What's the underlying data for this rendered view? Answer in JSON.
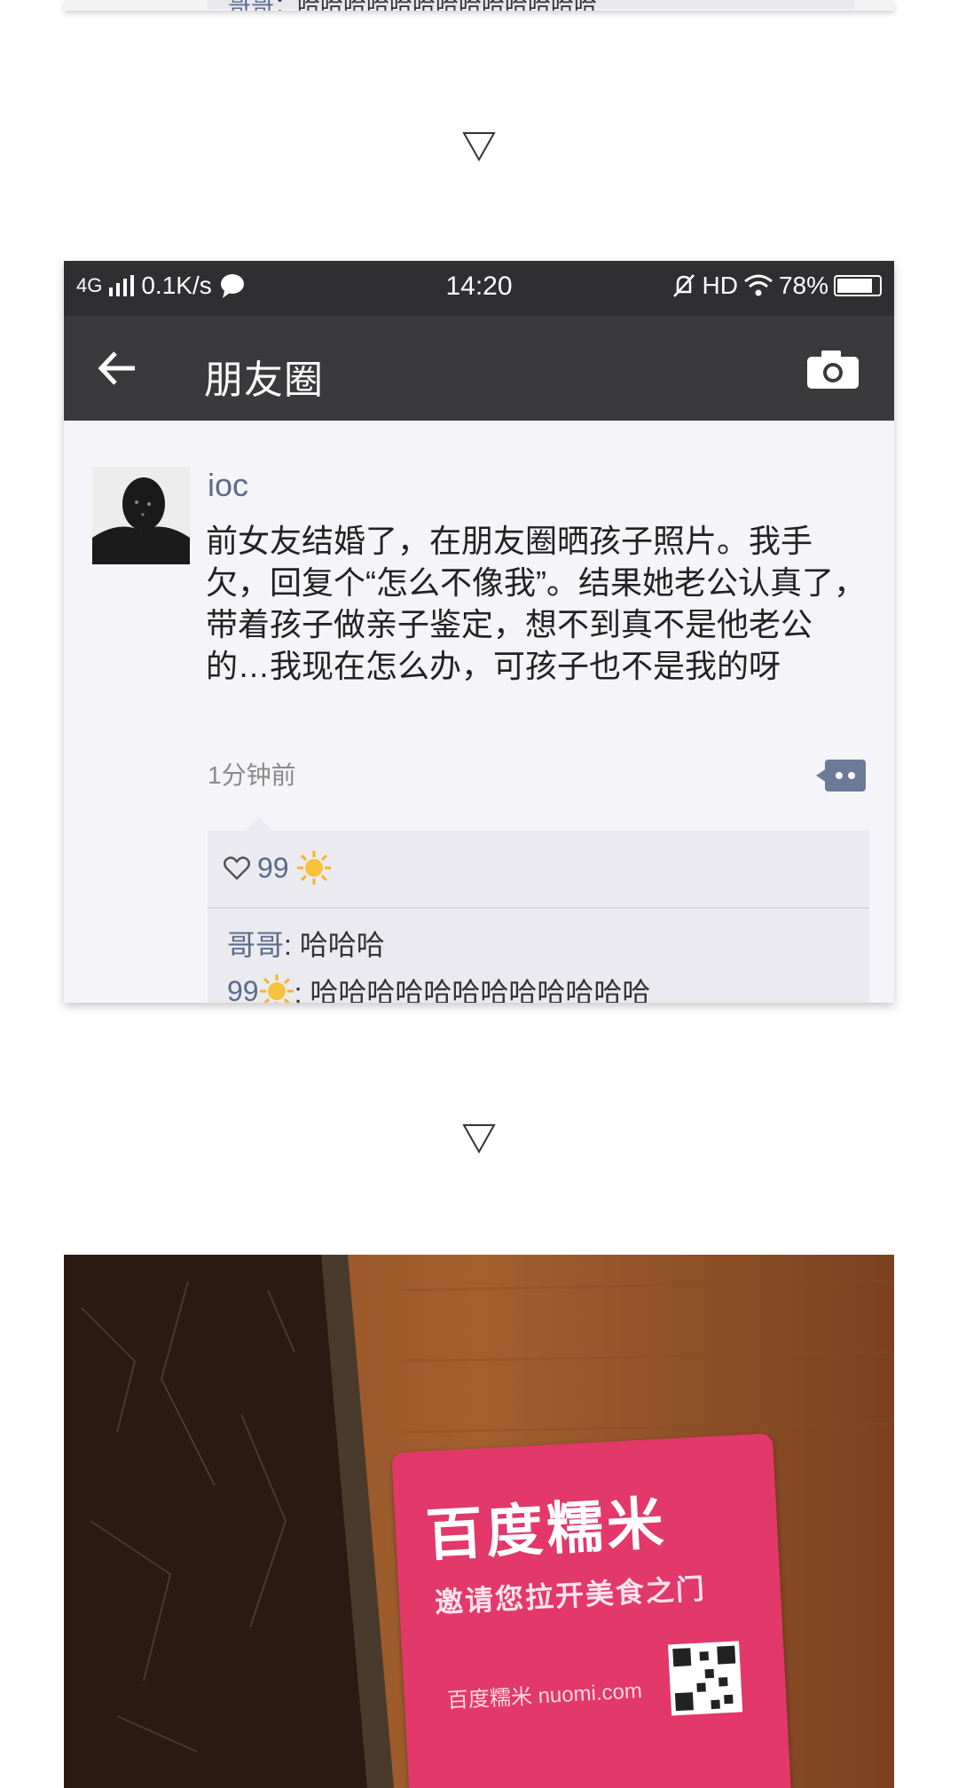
{
  "top_card": {
    "name": "哥哥",
    "text": "：哈哈哈哈哈哈哈哈哈哈哈哈哈"
  },
  "separators": [
    "▽",
    "▽"
  ],
  "screenshot": {
    "statusbar": {
      "network": "4G",
      "speed": "0.1K/s",
      "time": "14:20",
      "hd": "HD",
      "battery": "78%",
      "battery_level": 0.78
    },
    "nav": {
      "title": "朋友圈"
    },
    "post": {
      "username": "ioc",
      "text": "前女友结婚了，在朋友圈晒孩子照片。我手欠，回复个“怎么不像我”。结果她老公认真了，带着孩子做亲子鉴定，想不到真不是他老公的…我现在怎么办，可孩子也不是我的呀",
      "time": "1分钟前",
      "likes": "99"
    },
    "comments": [
      {
        "name": "哥哥",
        "text": ": 哈哈哈"
      },
      {
        "name": "99",
        "text": ": 哈哈哈哈哈哈哈哈哈哈哈哈"
      }
    ]
  },
  "photo": {
    "brand": "百度糯米",
    "slogan": "邀请您拉开美食之门",
    "brand_small": "百度糯米 nuomi.com"
  },
  "icons": [
    "back-arrow-icon",
    "camera-icon",
    "heart-icon",
    "sun-emoji-icon",
    "comment-icon",
    "wifi-icon",
    "bell-off-icon",
    "battery-icon"
  ],
  "colors": {
    "statusbar": "#2f2f31",
    "navbar": "#3a3a3d",
    "link": "#5b6b8a",
    "card_pink": "#e2386a"
  }
}
